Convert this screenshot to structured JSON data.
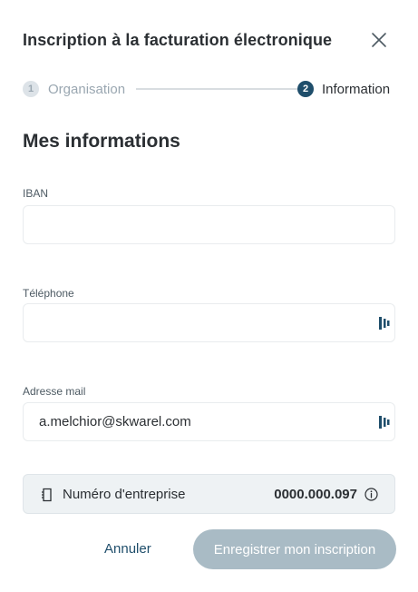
{
  "dialog": {
    "title": "Inscription à la facturation électronique",
    "close_icon": "close-icon"
  },
  "stepper": {
    "steps": [
      {
        "number": "1",
        "label": "Organisation",
        "state": "completed"
      },
      {
        "number": "2",
        "label": "Information",
        "state": "active"
      }
    ]
  },
  "section_title": "Mes informations",
  "fields": {
    "iban": {
      "label": "IBAN",
      "value": ""
    },
    "telephone": {
      "label": "Téléphone",
      "value": "",
      "icon": "autofill-icon"
    },
    "email": {
      "label": "Adresse mail",
      "value": "a.melchior@skwarel.com",
      "icon": "autofill-icon"
    }
  },
  "company_number": {
    "label": "Numéro d'entreprise",
    "value": "0000.000.097",
    "icon": "document-icon",
    "info_icon": "info-icon"
  },
  "actions": {
    "cancel_label": "Annuler",
    "submit_label": "Enregistrer mon inscription"
  },
  "colors": {
    "primary": "#1f4e6b",
    "submit_disabled": "#a9bbc5",
    "info_bg": "#eef2f4"
  }
}
